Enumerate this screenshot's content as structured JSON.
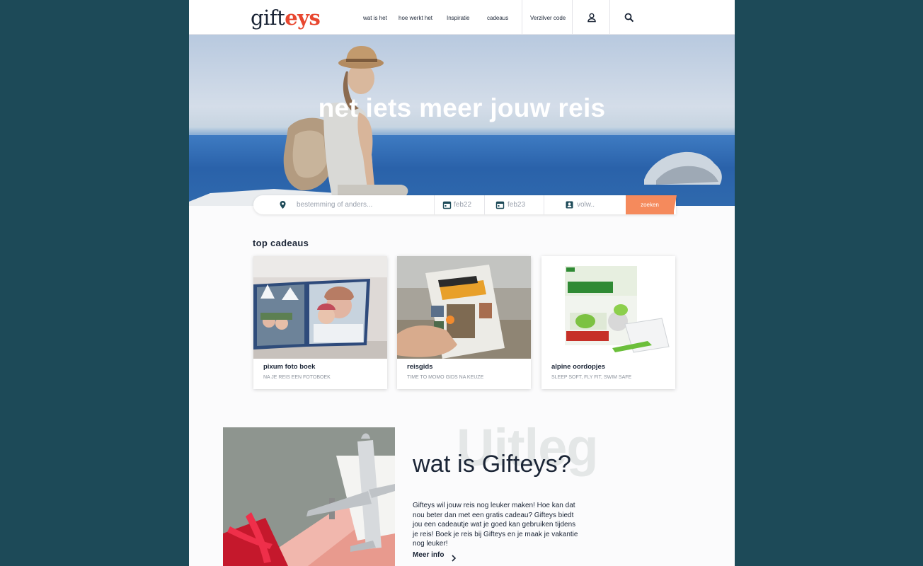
{
  "brand": {
    "logo_part1": "gift",
    "logo_part2": "eys",
    "accent": "#e8472f",
    "ink": "#1b2536"
  },
  "nav": {
    "items": [
      "wat is het",
      "hoe werkt het",
      "Inspiratie",
      "cadeaus"
    ],
    "redeem_code": "Verzilver code",
    "icons": [
      "user-icon",
      "search-icon"
    ]
  },
  "hero": {
    "title": "net iets meer jouw reis"
  },
  "search": {
    "destination_placeholder": "bestemming of anders...",
    "date_from": "feb22",
    "date_to": "feb23",
    "travelers": "volw..",
    "button_label": "zoeken",
    "button_color": "#f58a5c"
  },
  "top_gifts": {
    "title": "top cadeaus",
    "cards": [
      {
        "title": "pixum foto boek",
        "subtitle": "NA JE REIS EEN FOTOBOEK"
      },
      {
        "title": "reisgids",
        "subtitle": "TIME TO MOMO GIDS NA KEUZE"
      },
      {
        "title": "alpine oordopjes",
        "subtitle": "SLEEP SOFT, FLY FIT, SWIM SAFE"
      }
    ]
  },
  "explain": {
    "watermark": "Uitleg",
    "title": "wat is Gifteys?",
    "body": "Gifteys wil jouw reis nog leuker maken! Hoe kan dat nou beter dan met een gratis cadeau? Gifteys biedt jou een cadeautje wat je goed kan gebruiken tijdens je reis! Boek je reis bij Gifteys en je maak je vakantie nog leuker!",
    "more_link": "Meer info"
  }
}
